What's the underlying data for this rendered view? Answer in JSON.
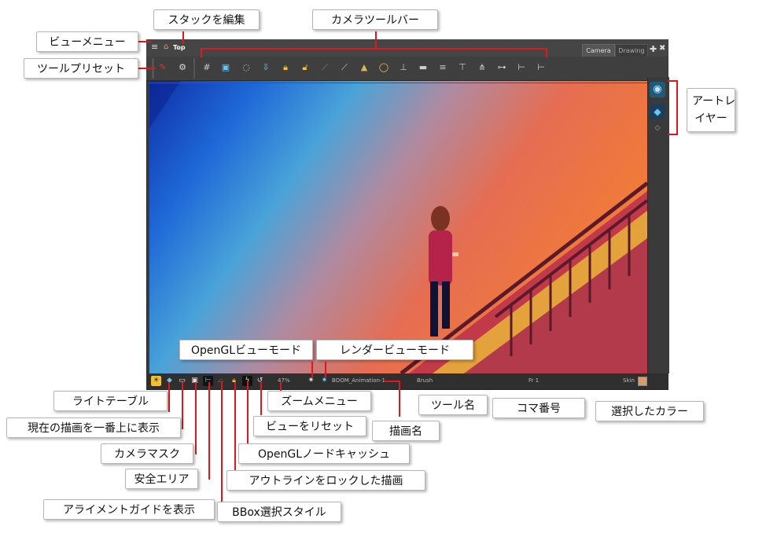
{
  "window": {
    "breadcrumb": "Top",
    "tabs": [
      "Camera",
      "Drawing"
    ],
    "toolbar_icons": [
      "tool-presets-icon",
      "settings-gear-icon",
      "grid-icon",
      "match-camera-icon",
      "onion-skin-icon",
      "peg-icon",
      "lock-icon",
      "unlock-icon",
      "ruler-icon",
      "pencil-guide-icon",
      "light-icon",
      "bulb-icon",
      "shadow-icon",
      "flip-icon",
      "rotate-icon",
      "box-icon",
      "hierarchy-icon",
      "axis-icon",
      "axis-plus-icon"
    ]
  },
  "status_bar": {
    "zoom": "47%",
    "drawing_name": "BOOM_Animation-1",
    "tool_name": "Brush",
    "frame": "Fr 1",
    "color_label": "Skin",
    "selected_color": "#d99a6c"
  },
  "callouts": {
    "edit_stack": "スタックを編集",
    "camera_toolbar": "カメラツールバー",
    "view_menu": "ビューメニュー",
    "tool_presets": "ツールプリセット",
    "art_layer_line1": "アートレ",
    "art_layer_line2": "イヤー",
    "opengl_view_mode": "OpenGLビューモード",
    "render_view_mode": "レンダービューモード",
    "light_table": "ライトテーブル",
    "zoom_menu": "ズームメニュー",
    "tool_name": "ツール名",
    "frame_number": "コマ番号",
    "selected_color": "選択したカラー",
    "show_current_drawing_on_top": "現在の描画を一番上に表示",
    "reset_view": "ビューをリセット",
    "drawing_name": "描画名",
    "camera_mask": "カメラマスク",
    "opengl_node_cache": "OpenGLノードキャッシュ",
    "safe_area": "安全エリア",
    "outline_locked_drawing": "アウトラインをロックした描画",
    "show_alignment_guides": "アライメントガイドを表示",
    "bbox_selection_style": "BBox選択スタイル"
  }
}
